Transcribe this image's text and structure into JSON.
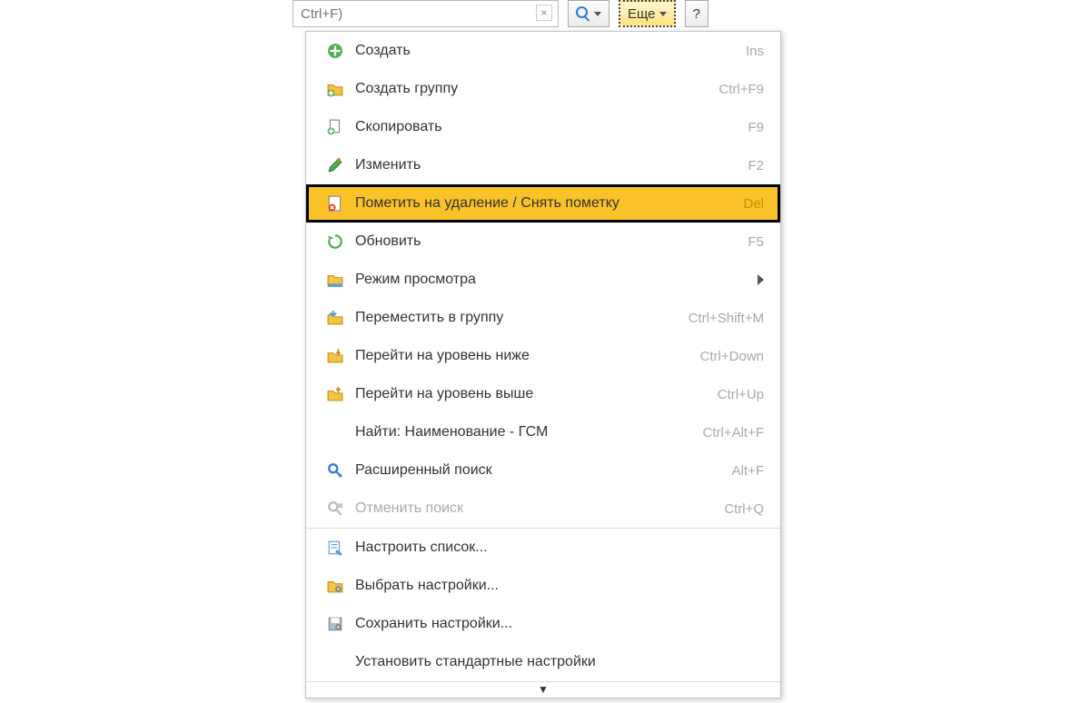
{
  "toolbar": {
    "search_placeholder": "Ctrl+F)",
    "more_label": "Еще",
    "help_label": "?"
  },
  "menu": {
    "items": [
      {
        "label": "Создать",
        "shortcut": "Ins",
        "icon": "create-icon"
      },
      {
        "label": "Создать группу",
        "shortcut": "Ctrl+F9",
        "icon": "create-group-icon"
      },
      {
        "label": "Скопировать",
        "shortcut": "F9",
        "icon": "copy-icon"
      },
      {
        "label": "Изменить",
        "shortcut": "F2",
        "icon": "edit-icon"
      },
      {
        "label": "Пометить на удаление / Снять пометку",
        "shortcut": "Del",
        "icon": "mark-delete-icon",
        "highlighted": true
      },
      {
        "label": "Обновить",
        "shortcut": "F5",
        "icon": "refresh-icon"
      },
      {
        "label": "Режим просмотра",
        "shortcut": "",
        "icon": "view-mode-icon",
        "submenu": true
      },
      {
        "label": "Переместить в группу",
        "shortcut": "Ctrl+Shift+M",
        "icon": "move-to-group-icon"
      },
      {
        "label": "Перейти на уровень ниже",
        "shortcut": "Ctrl+Down",
        "icon": "level-down-icon"
      },
      {
        "label": "Перейти на уровень выше",
        "shortcut": "Ctrl+Up",
        "icon": "level-up-icon"
      },
      {
        "label": "Найти: Наименование - ГСМ",
        "shortcut": "Ctrl+Alt+F",
        "icon": ""
      },
      {
        "label": "Расширенный поиск",
        "shortcut": "Alt+F",
        "icon": "adv-search-icon"
      },
      {
        "label": "Отменить поиск",
        "shortcut": "Ctrl+Q",
        "icon": "cancel-search-icon",
        "disabled": true
      },
      {
        "sep": true
      },
      {
        "label": "Настроить список...",
        "shortcut": "",
        "icon": "configure-list-icon"
      },
      {
        "label": "Выбрать настройки...",
        "shortcut": "",
        "icon": "choose-settings-icon"
      },
      {
        "label": "Сохранить настройки...",
        "shortcut": "",
        "icon": "save-settings-icon"
      },
      {
        "label": "Установить стандартные настройки",
        "shortcut": "",
        "icon": ""
      }
    ]
  }
}
